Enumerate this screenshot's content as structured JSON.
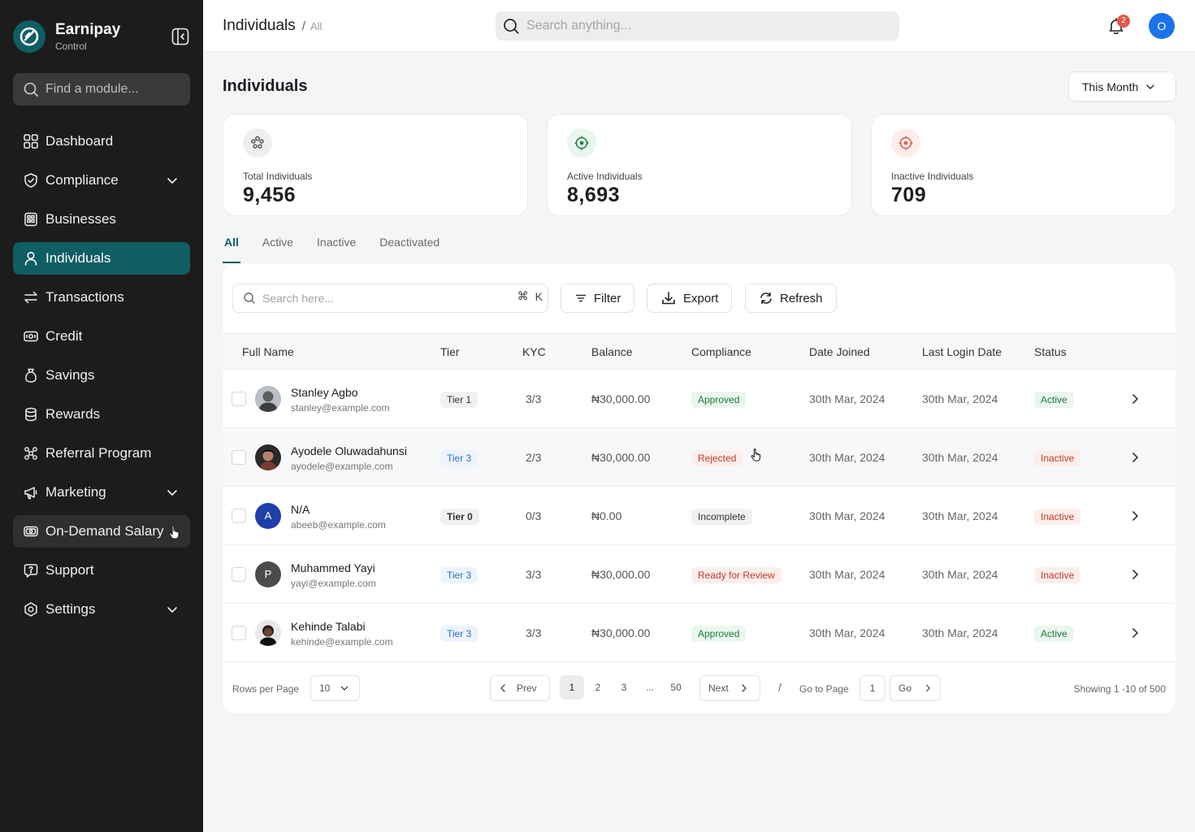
{
  "brand": {
    "name": "Earnipay",
    "subtitle": "Control"
  },
  "sidebar": {
    "search_placeholder": "Find a module...",
    "items": [
      {
        "label": "Dashboard",
        "icon": "dashboard-icon"
      },
      {
        "label": "Compliance",
        "icon": "shield-icon",
        "expandable": true
      },
      {
        "label": "Businesses",
        "icon": "building-icon"
      },
      {
        "label": "Individuals",
        "icon": "user-icon",
        "active": true
      },
      {
        "label": "Transactions",
        "icon": "swap-icon"
      },
      {
        "label": "Credit",
        "icon": "money-icon"
      },
      {
        "label": "Savings",
        "icon": "moneybag-icon"
      },
      {
        "label": "Rewards",
        "icon": "coins-icon"
      },
      {
        "label": "Referral Program",
        "icon": "network-icon"
      },
      {
        "label": "Marketing",
        "icon": "megaphone-icon",
        "expandable": true
      },
      {
        "label": "On-Demand Salary",
        "icon": "cash-icon",
        "hovered": true
      },
      {
        "label": "Support",
        "icon": "help-icon"
      },
      {
        "label": "Settings",
        "icon": "settings-icon",
        "expandable": true
      }
    ]
  },
  "header": {
    "breadcrumb": {
      "section": "Individuals",
      "separator": "/",
      "current": "All"
    },
    "search_placeholder": "Search anything...",
    "notification_count": "2",
    "avatar_initial": "O"
  },
  "page": {
    "title": "Individuals",
    "period": "This Month",
    "stats": [
      {
        "label": "Total Individuals",
        "value": "9,456",
        "icon": "users-group-icon"
      },
      {
        "label": "Active Individuals",
        "value": "8,693",
        "icon": "active-target-icon"
      },
      {
        "label": "Inactive Individuals",
        "value": "709",
        "icon": "inactive-target-icon"
      }
    ],
    "tabs": [
      "All",
      "Active",
      "Inactive",
      "Deactivated"
    ],
    "active_tab": "All"
  },
  "toolbar": {
    "search_placeholder": "Search here...",
    "shortcut_symbol": "⌘",
    "shortcut_key": "K",
    "filter_label": "Filter",
    "export_label": "Export",
    "refresh_label": "Refresh"
  },
  "table": {
    "columns": [
      "Full Name",
      "Tier",
      "KYC",
      "Balance",
      "Compliance",
      "Date Joined",
      "Last Login Date",
      "Status"
    ],
    "rows": [
      {
        "name": "Stanley Agbo",
        "email": "stanley@example.com",
        "avatar": "photo",
        "tier": "Tier 1",
        "kyc": "3/3",
        "balance": "₦30,000.00",
        "compliance": "Approved",
        "date_joined": "30th Mar, 2024",
        "last_login": "30th Mar, 2024",
        "status": "Active"
      },
      {
        "name": "Ayodele Oluwadahunsi",
        "email": "ayodele@example.com",
        "avatar": "photo",
        "tier": "Tier 3",
        "kyc": "2/3",
        "balance": "₦30,000.00",
        "compliance": "Rejected",
        "date_joined": "30th Mar, 2024",
        "last_login": "30th Mar, 2024",
        "status": "Inactive"
      },
      {
        "name": "N/A",
        "email": "abeeb@example.com",
        "avatar": "A",
        "tier": "Tier 0",
        "kyc": "0/3",
        "balance": "₦0.00",
        "compliance": "Incomplete",
        "date_joined": "30th Mar, 2024",
        "last_login": "30th Mar, 2024",
        "status": "Inactive"
      },
      {
        "name": "Muhammed Yayi",
        "email": "yayi@example.com",
        "avatar": "P",
        "tier": "Tier 3",
        "kyc": "3/3",
        "balance": "₦30,000.00",
        "compliance": "Ready for Review",
        "date_joined": "30th Mar, 2024",
        "last_login": "30th Mar, 2024",
        "status": "Inactive"
      },
      {
        "name": "Kehinde Talabi",
        "email": "kehinde@example.com",
        "avatar": "photo",
        "tier": "Tier 3",
        "kyc": "3/3",
        "balance": "₦30,000.00",
        "compliance": "Approved",
        "date_joined": "30th Mar, 2024",
        "last_login": "30th Mar, 2024",
        "status": "Active"
      }
    ]
  },
  "pagination": {
    "rows_per_page_label": "Rows per Page",
    "rows_per_page_value": "10",
    "prev_label": "Prev",
    "next_label": "Next",
    "pages": [
      "1",
      "2",
      "3",
      "...",
      "50"
    ],
    "current_page": "1",
    "slash": "/",
    "goto_label": "Go to Page",
    "goto_value": "1",
    "go_label": "Go",
    "showing": "Showing 1 -10 of 500"
  },
  "colors": {
    "brand": "#0f5e63",
    "sidebar_bg": "#1c1c1c",
    "approved": "#1d7a3e",
    "rejected": "#c0392b",
    "tier3": "#2a71c8"
  }
}
